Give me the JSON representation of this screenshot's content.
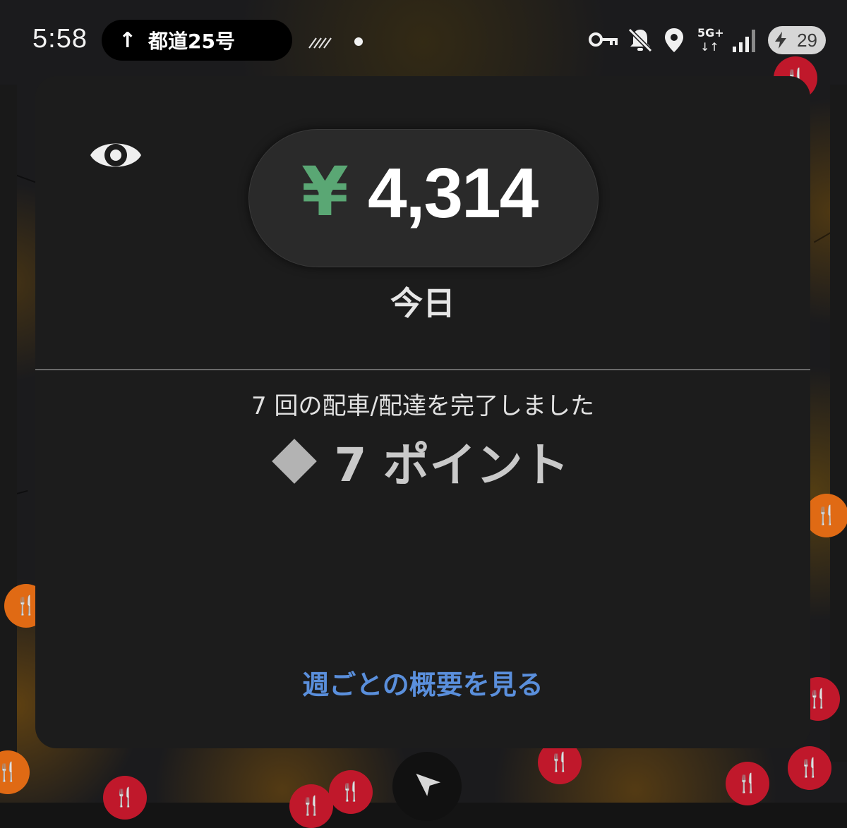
{
  "status_bar": {
    "time": "5:58",
    "navigation": {
      "arrow": "↑",
      "road": "都道25号 "
    },
    "battery_level": "29",
    "icons": [
      "stripes-icon",
      "dot-icon",
      "vpn-key-icon",
      "mute-icon",
      "location-icon",
      "5g-plus-icon",
      "signal-icon",
      "battery-charging-icon"
    ]
  },
  "earnings": {
    "currency_symbol": "¥",
    "amount": "4,314",
    "period": "今日"
  },
  "summary": {
    "trips_text": "7 回の配車/配達を完了しました",
    "points_text": "7 ポイント"
  },
  "links": {
    "weekly_overview": "週ごとの概要を見る"
  },
  "colors": {
    "currency_green": "#5aa774",
    "link_blue": "#5a8fdc",
    "card_background": "#1c1c1c",
    "marker_red": "#c0182b"
  }
}
